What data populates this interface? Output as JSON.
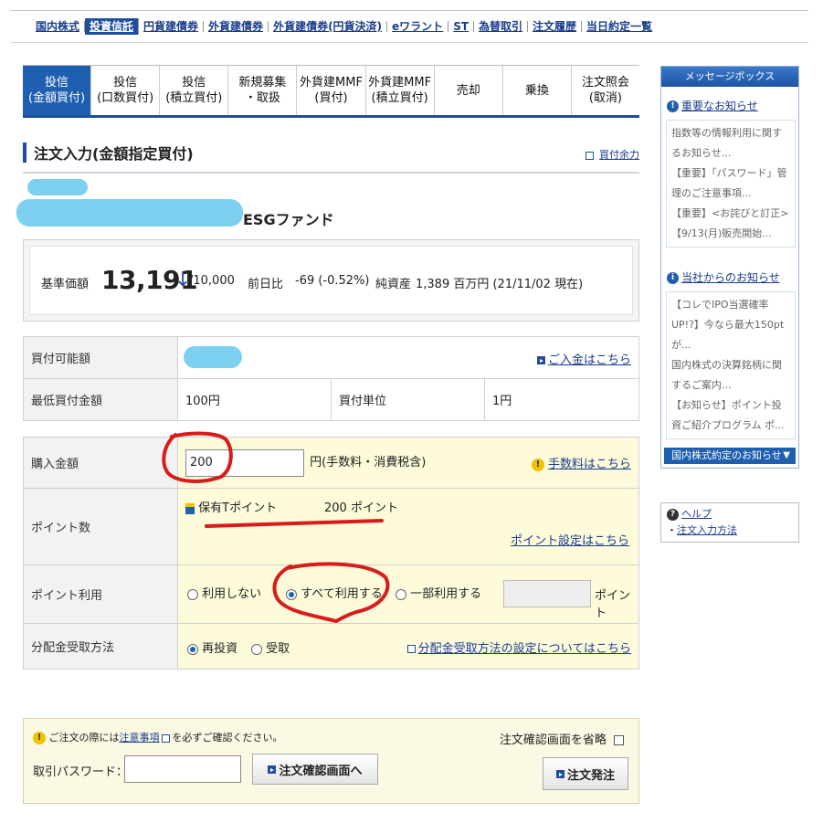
{
  "top_nav": [
    "国内株式",
    "投資信託",
    "円貨建債券",
    "外貨建債券",
    "外貨建債券(円貨決済)",
    "eワラント",
    "ST",
    "為替取引",
    "注文履歴",
    "当日約定一覧"
  ],
  "tabs": [
    {
      "label": "投信\n(金額買付)",
      "active": true
    },
    {
      "label": "投信\n(口数買付)",
      "active": false
    },
    {
      "label": "投信\n(積立買付)",
      "active": false
    },
    {
      "label": "新規募集\n・取扱",
      "active": false
    },
    {
      "label": "外貨建MMF\n(買付)",
      "active": false
    },
    {
      "label": "外貨建MMF\n(積立買付)",
      "active": false
    },
    {
      "label": "売却",
      "active": false
    },
    {
      "label": "乗換",
      "active": false
    },
    {
      "label": "注文照会\n(取消)",
      "active": false
    }
  ],
  "page_title": "注文入力(金額指定買付)",
  "side_link": "買付余力",
  "fund_name": "ESGファンド",
  "price": {
    "label": "基準価額",
    "value": "13,191",
    "arrow": "↓",
    "unit": "/10,000",
    "change_label": "前日比",
    "change": "-69 (-0.52%)",
    "nav_label": "純資産",
    "nav_value": "1,389 百万円 (21/11/02 現在)"
  },
  "info_table": {
    "buyable_label": "買付可能額",
    "deposit_link": "ご入金はこちら",
    "min_label": "最低買付金額",
    "min_value": "100円",
    "unit_label": "買付単位",
    "unit_value": "1円"
  },
  "order_form": {
    "amount_label": "購入金額",
    "amount_value": "200",
    "amount_suffix": "円(手数料・消費税含)",
    "fee_link": "手数料はこちら",
    "points_label": "ポイント数",
    "points_held_label": "保有Tポイント",
    "points_held_value": "200 ポイント",
    "points_setting_link": "ポイント設定はこちら",
    "point_use_label": "ポイント利用",
    "point_use_options": [
      "利用しない",
      "すべて利用する",
      "一部利用する"
    ],
    "point_use_selected": 1,
    "point_unit": "ポイント",
    "dist_label": "分配金受取方法",
    "dist_options": [
      "再投資",
      "受取"
    ],
    "dist_selected": 0,
    "dist_link": "分配金受取方法の設定についてはこちら"
  },
  "footer": {
    "notice_pre": "ご注文の際には",
    "notice_link": "注意事項",
    "notice_post": "を必ずご確認ください。",
    "skip_confirm_label": "注文確認画面を省略",
    "password_label": "取引パスワード：",
    "confirm_button": "注文確認画面へ",
    "order_button": "注文発注"
  },
  "message_box": {
    "title": "メッセージボックス",
    "important_header": "重要なお知らせ",
    "important_items": [
      "指数等の情報利用に関するお知らせ...",
      "【重要】「パスワード」管理のご注意事項...",
      "【重要】<お詫びと訂正>【9/13(月)販売開始..."
    ],
    "company_header": "当社からのお知らせ",
    "company_items": [
      "【コレでIPO当選確率UP!?】今なら最大150ptが...",
      "国内株式の決算銘柄に関するご案内...",
      "【お知らせ】ポイント投資ご紹介プログラム ポ..."
    ],
    "footer": "国内株式約定のお知らせ"
  },
  "help": {
    "help_link": "ヘルプ",
    "order_method_link": "注文入力方法"
  },
  "colors": {
    "accent": "#1f4e9c",
    "annotation": "#d81b1b",
    "redaction": "#7ed0f0"
  }
}
